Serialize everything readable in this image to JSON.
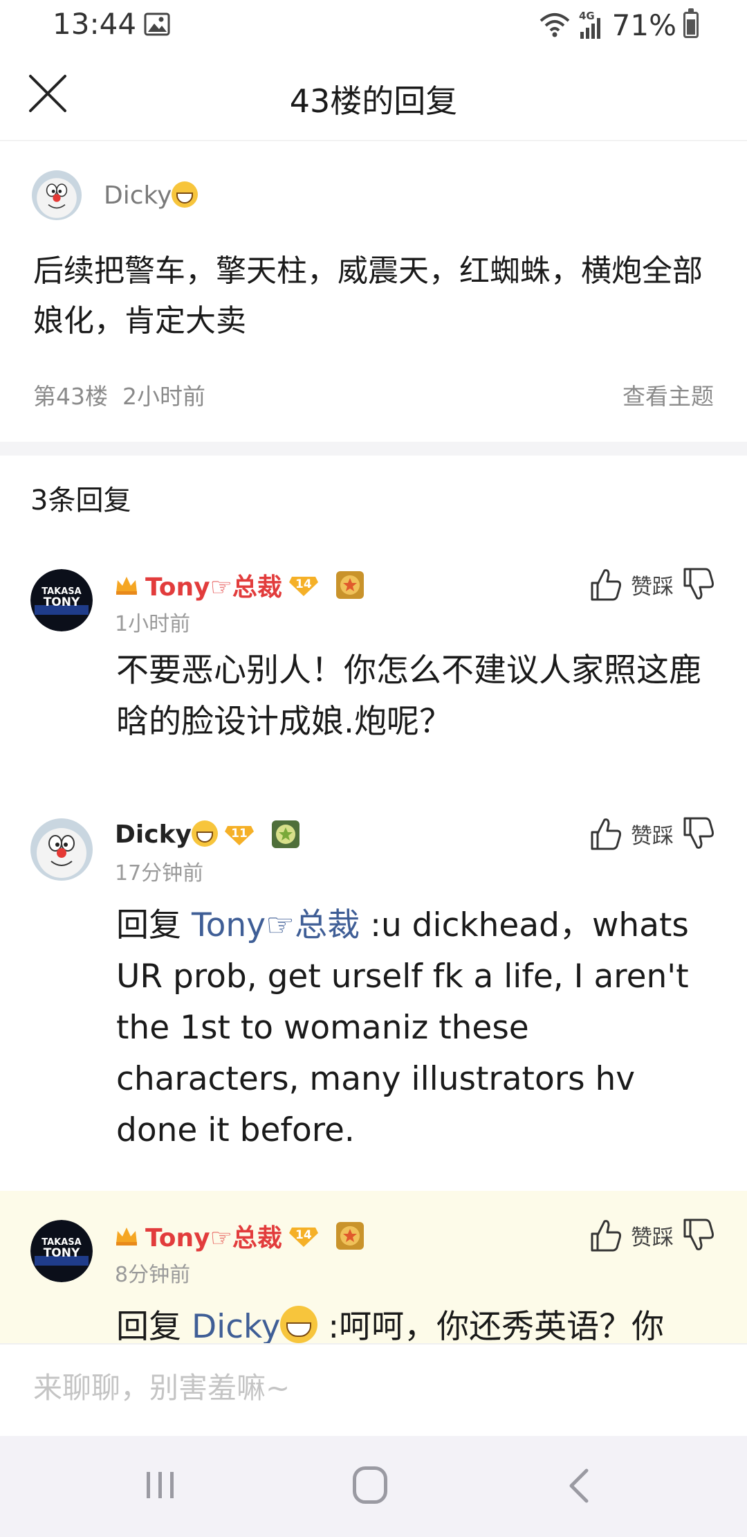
{
  "status_bar": {
    "time": "13:44",
    "network": "4G",
    "battery": "71%"
  },
  "header": {
    "title": "43楼的回复"
  },
  "post": {
    "author": "Dicky",
    "content": "后续把警车，擎天柱，威震天，红蜘蛛，横炮全部娘化，肯定大卖",
    "floor": "第43楼",
    "time": "2小时前",
    "view_topic": "查看主题"
  },
  "reply_count": "3条回复",
  "replies": [
    {
      "name": "Tony☞总裁",
      "level": "14",
      "time": "1小时前",
      "content": "不要恶心别人！你怎么不建议人家照这鹿晗的脸设计成娘.炮呢？",
      "vote_label": "赞踩"
    },
    {
      "name": "Dicky",
      "level": "11",
      "time": "17分钟前",
      "prefix": "回复",
      "mention": "Tony☞总裁",
      "content": " :u dickhead，whats UR prob, get urself fk a life, I aren't the 1st to womaniz these characters, many illustrators hv done it before.",
      "vote_label": "赞踩"
    },
    {
      "name": "Tony☞总裁",
      "level": "14",
      "time": "8分钟前",
      "prefix": "回复",
      "mention": "Dicky",
      "content": " :呵呵，你还秀英语？你",
      "vote_label": "赞踩"
    }
  ],
  "input": {
    "placeholder": "来聊聊，别害羞嘛~"
  },
  "avatars": {
    "dicky": "doraemon-avatar",
    "tony": "takasa-tony-avatar",
    "tony_text_1": "TAKASA",
    "tony_text_2": "TONY"
  },
  "colors": {
    "name_red": "#e23c3c",
    "mention_blue": "#3f5e96",
    "highlight_bg": "#fdfbe9",
    "badge_orange": "#f5a623"
  }
}
